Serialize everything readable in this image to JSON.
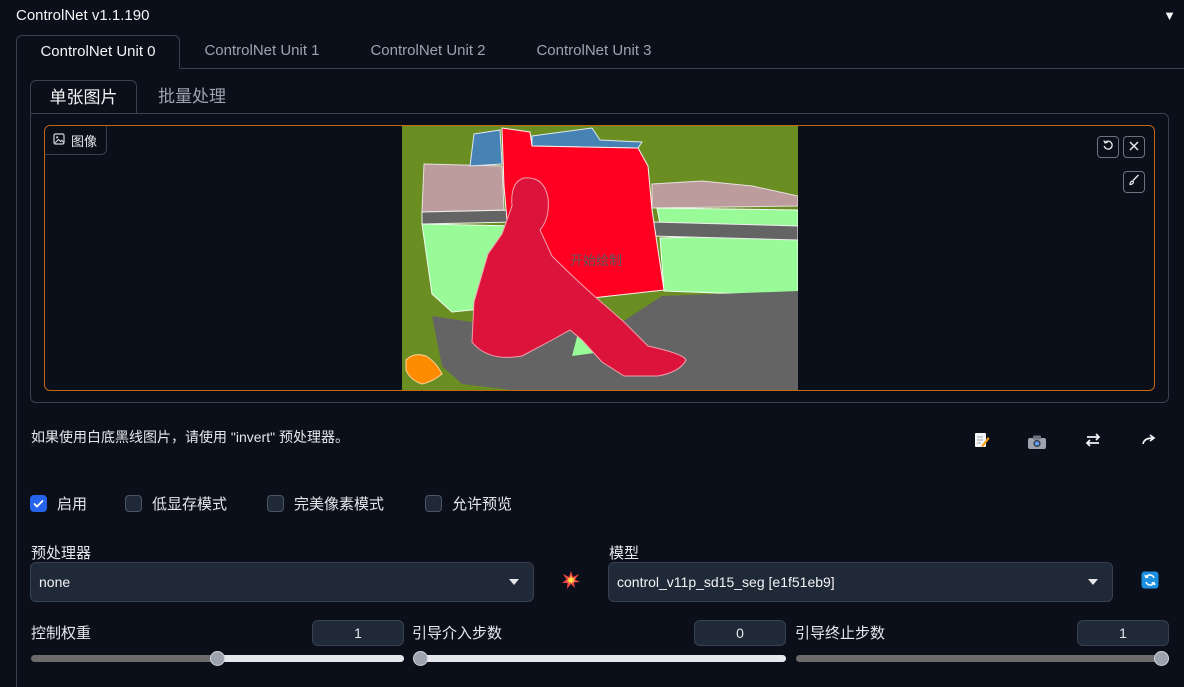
{
  "header": {
    "title": "ControlNet v1.1.190",
    "toggle_icon": "▼"
  },
  "unit_tabs": [
    {
      "label": "ControlNet Unit 0",
      "active": true
    },
    {
      "label": "ControlNet Unit 1",
      "active": false
    },
    {
      "label": "ControlNet Unit 2",
      "active": false
    },
    {
      "label": "ControlNet Unit 3",
      "active": false
    }
  ],
  "image_tabs": [
    {
      "label": "单张图片",
      "active": true
    },
    {
      "label": "批量处理",
      "active": false
    }
  ],
  "canvas": {
    "label": "图像",
    "hint": "开始绘制",
    "accent_border": "#c2670f"
  },
  "info_text": "如果使用白底黑线图片，请使用 \"invert\" 预处理器。",
  "action_icons": [
    "edit-icon",
    "camera-icon",
    "swap-icon",
    "send-icon"
  ],
  "checkboxes": [
    {
      "label": "启用",
      "checked": true
    },
    {
      "label": "低显存模式",
      "checked": false
    },
    {
      "label": "完美像素模式",
      "checked": false
    },
    {
      "label": "允许预览",
      "checked": false
    }
  ],
  "preprocessor": {
    "label": "预处理器",
    "value": "none"
  },
  "model": {
    "label": "模型",
    "value": "control_v11p_sd15_seg [e1f51eb9]"
  },
  "sliders": [
    {
      "label": "控制权重",
      "value": "1",
      "fraction": 0.5
    },
    {
      "label": "引导介入步数",
      "value": "0",
      "fraction": 0.0
    },
    {
      "label": "引导终止步数",
      "value": "1",
      "fraction": 1.0
    }
  ],
  "colors": {
    "background": "#0b0f19",
    "accent_blue": "#2563eb",
    "seg_person": "#dc143c",
    "seg_building": "#ff0022",
    "seg_grass": "#98fb98",
    "seg_tree": "#6b8e23",
    "seg_road": "#646464"
  }
}
